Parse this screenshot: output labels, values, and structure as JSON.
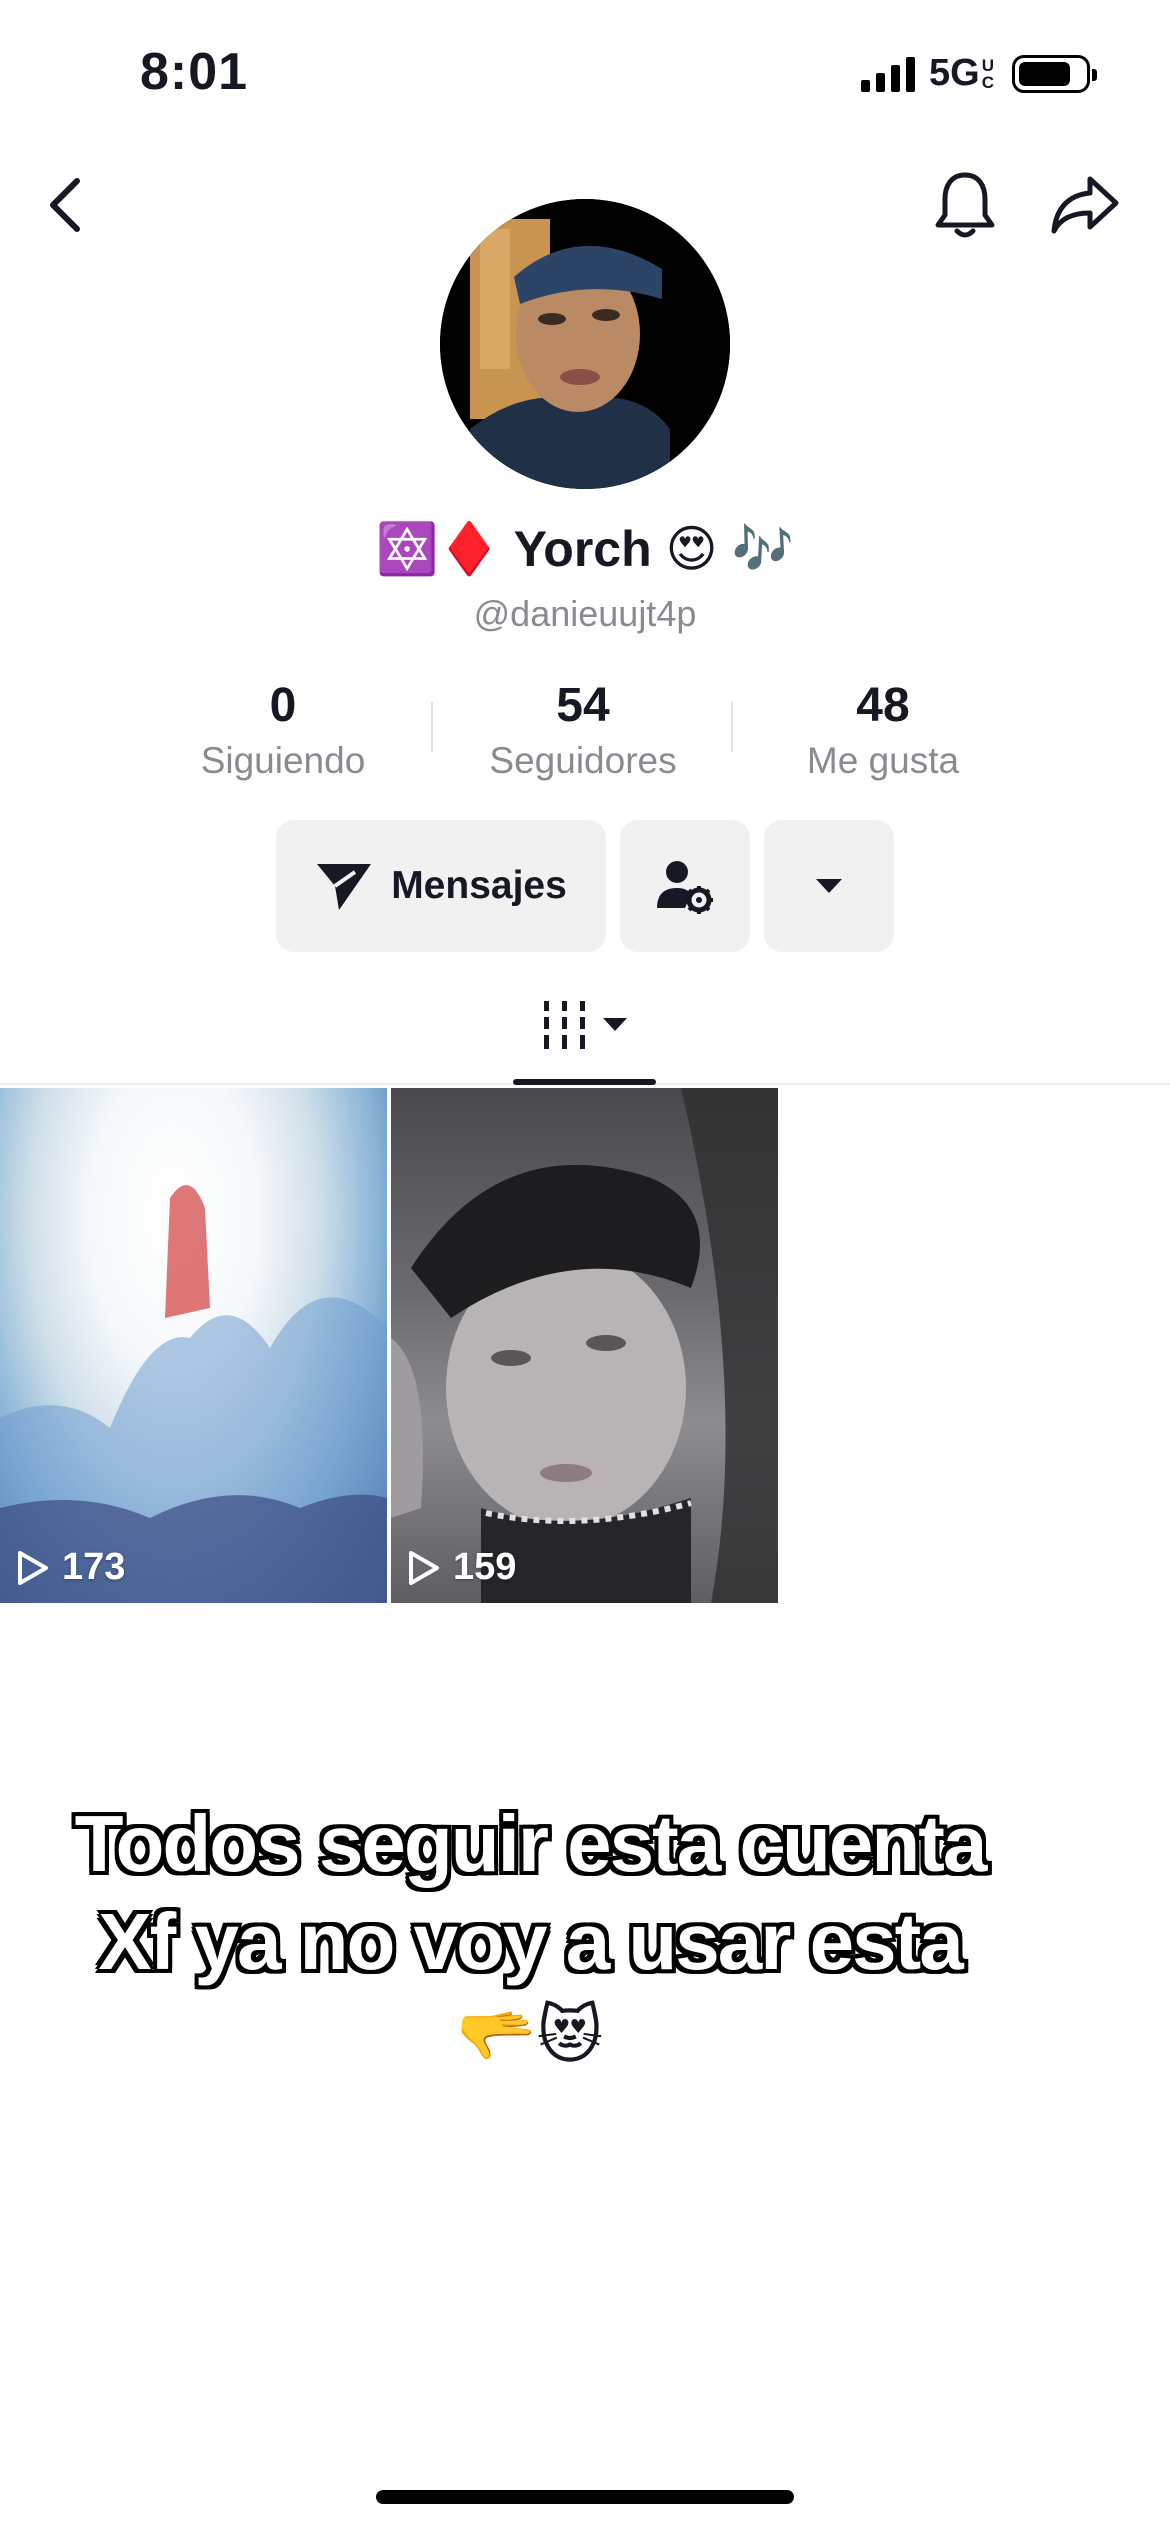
{
  "status_bar": {
    "time": "8:01",
    "network": "5G",
    "network_sub_top": "U",
    "network_sub_bottom": "C"
  },
  "profile": {
    "display_name": "🔯♦️ Yorch 😍 🎶",
    "username": "@danieuujt4p"
  },
  "stats": [
    {
      "value": "0",
      "label": "Siguiendo"
    },
    {
      "value": "54",
      "label": "Seguidores"
    },
    {
      "value": "48",
      "label": "Me gusta"
    }
  ],
  "actions": {
    "message_label": "Mensajes"
  },
  "videos": [
    {
      "views": "173"
    },
    {
      "views": "159"
    }
  ],
  "caption": {
    "line1": "Todos seguir esta cuenta",
    "line2": "Xf ya no voy a usar esta",
    "emoji": "🫳😻"
  },
  "colors": {
    "text_primary": "#161823",
    "text_secondary": "#8a8b91",
    "button_bg": "#f1f1f2"
  }
}
